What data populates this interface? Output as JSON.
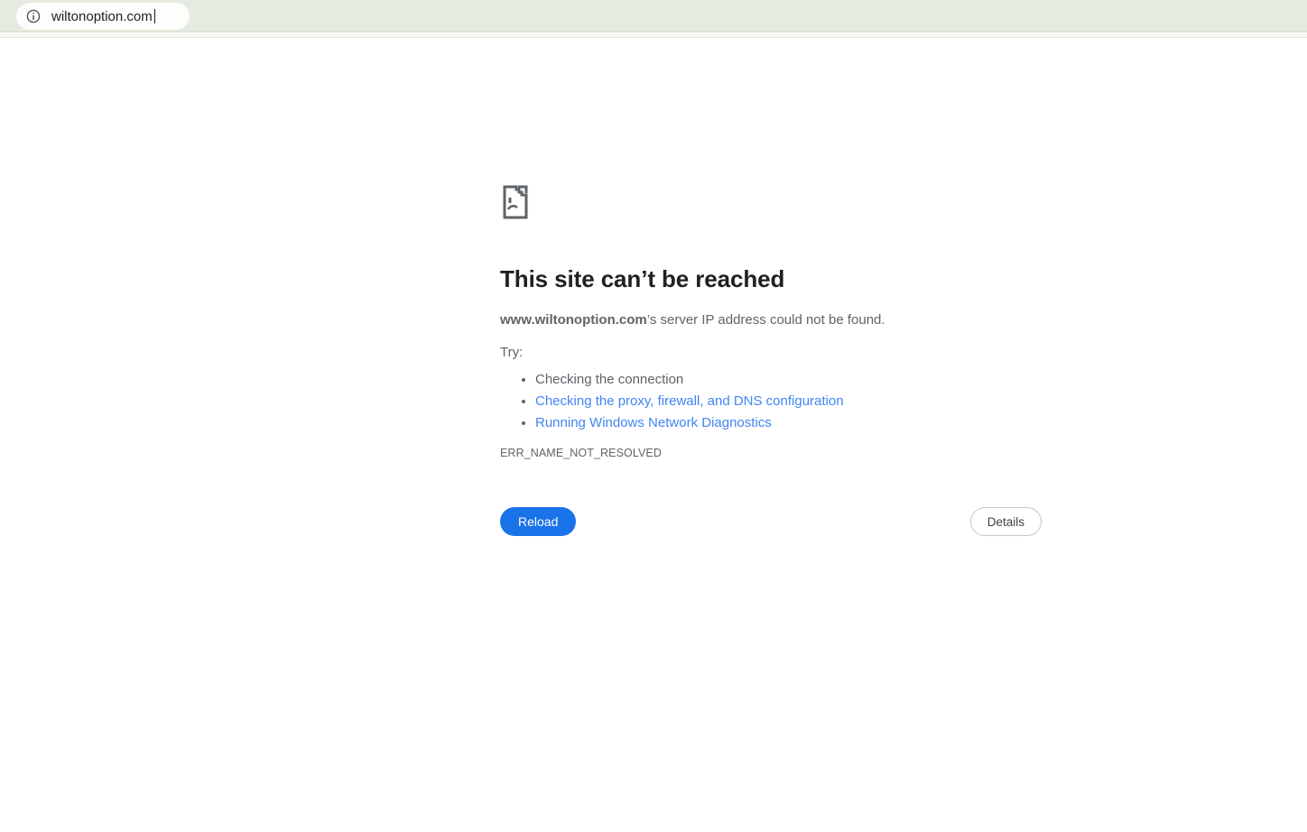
{
  "browser": {
    "url": "wiltonoption.com"
  },
  "error_page": {
    "title": "This site can’t be reached",
    "subtitle_domain": "www.wiltonoption.com",
    "subtitle_rest": "’s server IP address could not be found.",
    "try_label": "Try:",
    "suggestions": [
      {
        "label": "Checking the connection",
        "is_link": false
      },
      {
        "label": "Checking the proxy, firewall, and DNS configuration",
        "is_link": true
      },
      {
        "label": "Running Windows Network Diagnostics",
        "is_link": true
      }
    ],
    "error_code": "ERR_NAME_NOT_RESOLVED",
    "reload_label": "Reload",
    "details_label": "Details"
  },
  "colors": {
    "toolbar_bg": "#e5ebdf",
    "omnibox_bg": "#fdfdfc",
    "link_blue": "#4285f4",
    "reload_button_blue": "#1a73e8",
    "body_text_grey": "#5f6368",
    "heading_text": "#202124"
  }
}
